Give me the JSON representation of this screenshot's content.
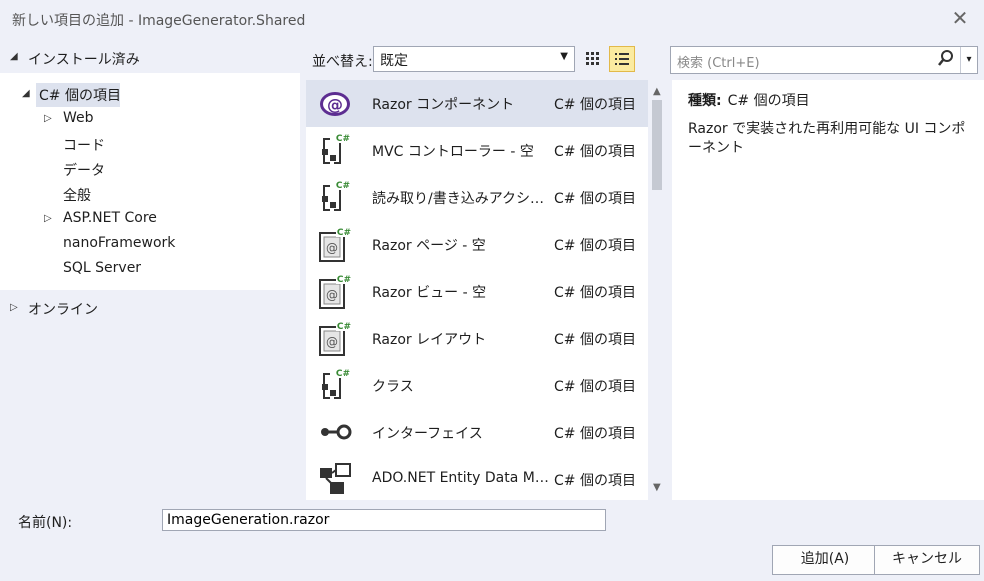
{
  "window": {
    "title": "新しい項目の追加 - ImageGenerator.Shared",
    "close_glyph": "✕"
  },
  "sidebar": {
    "installed_label": "インストール済み",
    "tree": [
      {
        "label": "C# 個の項目"
      },
      {
        "label": "Web"
      },
      {
        "label": "コード"
      },
      {
        "label": "データ"
      },
      {
        "label": "全般"
      },
      {
        "label": "ASP.NET Core"
      },
      {
        "label": "nanoFramework"
      },
      {
        "label": "SQL Server"
      }
    ],
    "online_label": "オンライン"
  },
  "toolbar": {
    "sort_label": "並べ替え:",
    "sort_value": "既定",
    "grid_view_icon": "grid-view-icon",
    "list_view_icon": "list-view-icon"
  },
  "search": {
    "placeholder": "検索 (Ctrl+E)",
    "icon": "search-icon"
  },
  "templates": [
    {
      "name": "Razor コンポーネント",
      "type": "C# 個の項目",
      "icon": "blazor-icon"
    },
    {
      "name": "MVC コントローラー - 空",
      "type": "C# 個の項目",
      "icon": "csharp-class-icon"
    },
    {
      "name": "読み取り/書き込みアクションを含む MVC コントローラー",
      "type": "C# 個の項目",
      "icon": "csharp-class-icon"
    },
    {
      "name": "Razor ページ - 空",
      "type": "C# 個の項目",
      "icon": "razor-page-icon"
    },
    {
      "name": "Razor ビュー - 空",
      "type": "C# 個の項目",
      "icon": "razor-page-icon"
    },
    {
      "name": "Razor レイアウト",
      "type": "C# 個の項目",
      "icon": "razor-page-icon"
    },
    {
      "name": "クラス",
      "type": "C# 個の項目",
      "icon": "csharp-class-icon"
    },
    {
      "name": "インターフェイス",
      "type": "C# 個の項目",
      "icon": "interface-icon"
    },
    {
      "name": "ADO.NET Entity Data Model",
      "type": "C# 個の項目",
      "icon": "entity-model-icon"
    }
  ],
  "details": {
    "kind_label": "種類:",
    "kind_value": "C# 個の項目",
    "description": "Razor で実装された再利用可能な UI コンポーネント"
  },
  "footer": {
    "name_label": "名前(N):",
    "name_value": "ImageGeneration.razor",
    "add_label": "追加(A)",
    "cancel_label": "キャンセル"
  },
  "colors": {
    "accent_purple": "#5c2d91",
    "csharp_green": "#388a34",
    "selection": "#dde2ee"
  }
}
